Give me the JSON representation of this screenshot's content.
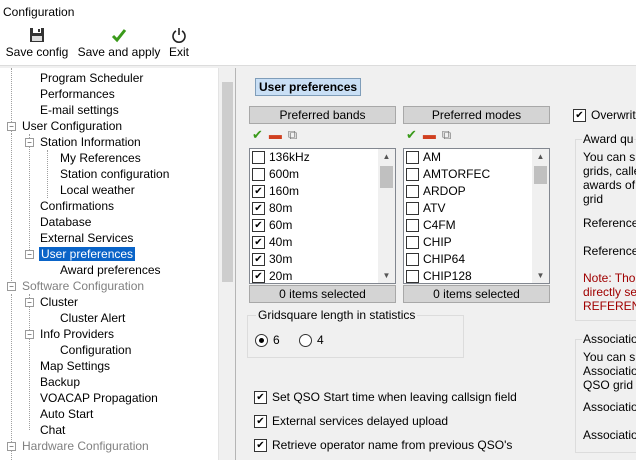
{
  "window": {
    "title": "Configuration"
  },
  "toolbar": {
    "save_config": "Save config",
    "save_and_apply": "Save and apply",
    "exit": "Exit"
  },
  "tree": {
    "program_scheduler": "Program Scheduler",
    "performances": "Performances",
    "email_settings": "E-mail settings",
    "user_configuration": "User Configuration",
    "station_information": "Station Information",
    "my_references": "My References",
    "station_configuration": "Station configuration",
    "local_weather": "Local weather",
    "confirmations": "Confirmations",
    "database": "Database",
    "external_services": "External Services",
    "user_preferences": "User preferences",
    "award_preferences": "Award preferences",
    "software_configuration": "Software Configuration",
    "cluster": "Cluster",
    "cluster_alert": "Cluster Alert",
    "info_providers": "Info Providers",
    "configuration": "Configuration",
    "map_settings": "Map Settings",
    "backup": "Backup",
    "voacap": "VOACAP Propagation",
    "auto_start": "Auto Start",
    "chat": "Chat",
    "hardware_configuration": "Hardware Configuration"
  },
  "main": {
    "section_title": "User preferences",
    "bands": {
      "header": "Preferred bands",
      "items": [
        {
          "label": "136kHz",
          "checked": false
        },
        {
          "label": "600m",
          "checked": false
        },
        {
          "label": "160m",
          "checked": true
        },
        {
          "label": "80m",
          "checked": true
        },
        {
          "label": "60m",
          "checked": true
        },
        {
          "label": "40m",
          "checked": true
        },
        {
          "label": "30m",
          "checked": true
        },
        {
          "label": "20m",
          "checked": true
        }
      ],
      "count": "0 items selected"
    },
    "modes": {
      "header": "Preferred modes",
      "items": [
        {
          "label": "AM",
          "checked": false
        },
        {
          "label": "AMTORFEC",
          "checked": false
        },
        {
          "label": "ARDOP",
          "checked": false
        },
        {
          "label": "ATV",
          "checked": false
        },
        {
          "label": "C4FM",
          "checked": false
        },
        {
          "label": "CHIP",
          "checked": false
        },
        {
          "label": "CHIP64",
          "checked": false
        },
        {
          "label": "CHIP128",
          "checked": false
        }
      ],
      "count": "0 items selected"
    },
    "gridsquare": {
      "legend": "Gridsquare length in statistics",
      "opt6": "6",
      "opt4": "4",
      "selected": "6"
    },
    "options": {
      "qso_start": "Set QSO Start time when leaving callsign field",
      "ext_upload": "External services delayed upload",
      "retrieve_name": "Retrieve operator name from previous QSO's"
    },
    "right": {
      "overwrite": "Overwrit",
      "award_legend": "Award qu",
      "award_line1": "You can s",
      "award_line2": "grids, calle",
      "award_line3": "awards of",
      "award_line4": "grid",
      "reference1": "Reference",
      "reference2": "Reference",
      "note1": "Note: Tho",
      "note2": "directly se",
      "note3": "REFERENC",
      "assoc_legend": "Associatio",
      "assoc_line1": "You can s",
      "assoc_line2": "Associatio",
      "assoc_line3": "QSO grid",
      "assoc_field1": "Associatio",
      "assoc_field2": "Associatio"
    }
  }
}
